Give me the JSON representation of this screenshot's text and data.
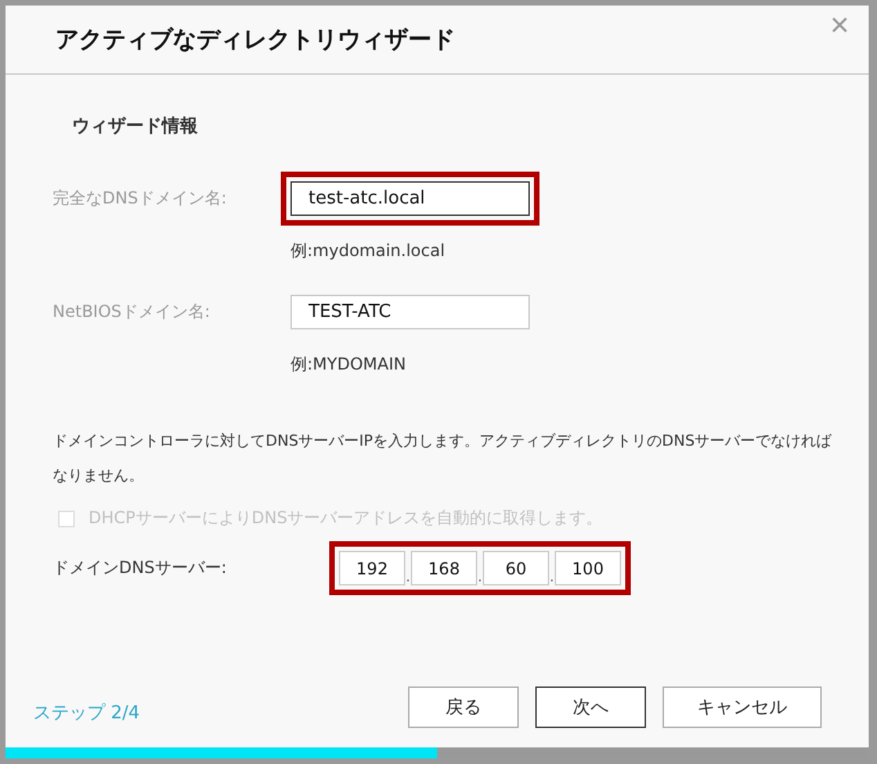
{
  "dialog": {
    "title": "アクティブなディレクトリウィザード",
    "close": "×"
  },
  "section": {
    "title": "ウィザード情報"
  },
  "fields": [
    {
      "label": "完全なDNSドメイン名:",
      "value": "test-atc.local",
      "hint": "例:mydomain.local",
      "highlighted": true,
      "disabled": true
    },
    {
      "label": "NetBIOSドメイン名:",
      "value": "TEST-ATC",
      "hint": "例:MYDOMAIN",
      "highlighted": false,
      "disabled": true
    }
  ],
  "description": "ドメインコントローラに対してDNSサーバーIPを入力します。アクティブディレクトリのDNSサーバーでなければなりません。",
  "dhcp_option": {
    "label": "DHCPサーバーによりDNSサーバーアドレスを自動的に取得します。",
    "checked": false,
    "disabled": true
  },
  "dns_server": {
    "label": "ドメインDNSサーバー:",
    "octets": [
      "192",
      "168",
      "60",
      "100"
    ],
    "separator": ".",
    "highlighted": true
  },
  "step": "ステップ 2/4",
  "buttons": [
    {
      "label": "戻る",
      "focused": false
    },
    {
      "label": "次へ",
      "focused": true
    },
    {
      "label": "キャンセル",
      "focused": false
    }
  ],
  "progress": {
    "level": 0.5
  }
}
